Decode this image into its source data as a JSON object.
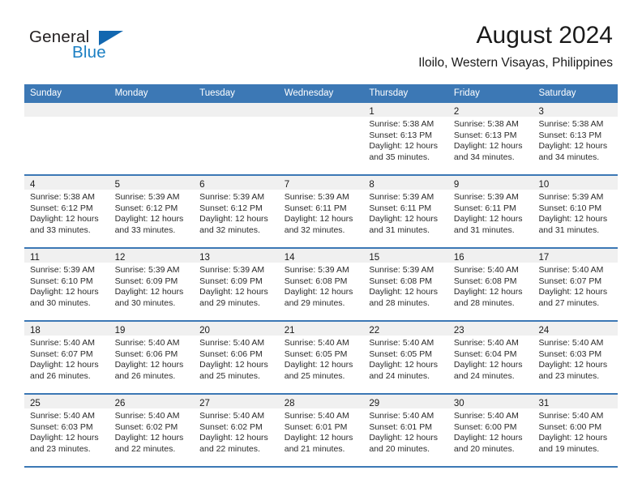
{
  "brand": {
    "name_part1": "General",
    "name_part2": "Blue"
  },
  "header": {
    "title": "August 2024",
    "location": "Iloilo, Western Visayas, Philippines"
  },
  "colors": {
    "header_blue": "#3c78b5",
    "brand_blue": "#1b7fc3",
    "day_band_gray": "#f0f0f0"
  },
  "weekdays": [
    "Sunday",
    "Monday",
    "Tuesday",
    "Wednesday",
    "Thursday",
    "Friday",
    "Saturday"
  ],
  "weeks": [
    [
      {
        "day": "",
        "sunrise": "",
        "sunset": "",
        "daylight1": "",
        "daylight2": ""
      },
      {
        "day": "",
        "sunrise": "",
        "sunset": "",
        "daylight1": "",
        "daylight2": ""
      },
      {
        "day": "",
        "sunrise": "",
        "sunset": "",
        "daylight1": "",
        "daylight2": ""
      },
      {
        "day": "",
        "sunrise": "",
        "sunset": "",
        "daylight1": "",
        "daylight2": ""
      },
      {
        "day": "1",
        "sunrise": "Sunrise: 5:38 AM",
        "sunset": "Sunset: 6:13 PM",
        "daylight1": "Daylight: 12 hours",
        "daylight2": "and 35 minutes."
      },
      {
        "day": "2",
        "sunrise": "Sunrise: 5:38 AM",
        "sunset": "Sunset: 6:13 PM",
        "daylight1": "Daylight: 12 hours",
        "daylight2": "and 34 minutes."
      },
      {
        "day": "3",
        "sunrise": "Sunrise: 5:38 AM",
        "sunset": "Sunset: 6:13 PM",
        "daylight1": "Daylight: 12 hours",
        "daylight2": "and 34 minutes."
      }
    ],
    [
      {
        "day": "4",
        "sunrise": "Sunrise: 5:38 AM",
        "sunset": "Sunset: 6:12 PM",
        "daylight1": "Daylight: 12 hours",
        "daylight2": "and 33 minutes."
      },
      {
        "day": "5",
        "sunrise": "Sunrise: 5:39 AM",
        "sunset": "Sunset: 6:12 PM",
        "daylight1": "Daylight: 12 hours",
        "daylight2": "and 33 minutes."
      },
      {
        "day": "6",
        "sunrise": "Sunrise: 5:39 AM",
        "sunset": "Sunset: 6:12 PM",
        "daylight1": "Daylight: 12 hours",
        "daylight2": "and 32 minutes."
      },
      {
        "day": "7",
        "sunrise": "Sunrise: 5:39 AM",
        "sunset": "Sunset: 6:11 PM",
        "daylight1": "Daylight: 12 hours",
        "daylight2": "and 32 minutes."
      },
      {
        "day": "8",
        "sunrise": "Sunrise: 5:39 AM",
        "sunset": "Sunset: 6:11 PM",
        "daylight1": "Daylight: 12 hours",
        "daylight2": "and 31 minutes."
      },
      {
        "day": "9",
        "sunrise": "Sunrise: 5:39 AM",
        "sunset": "Sunset: 6:11 PM",
        "daylight1": "Daylight: 12 hours",
        "daylight2": "and 31 minutes."
      },
      {
        "day": "10",
        "sunrise": "Sunrise: 5:39 AM",
        "sunset": "Sunset: 6:10 PM",
        "daylight1": "Daylight: 12 hours",
        "daylight2": "and 31 minutes."
      }
    ],
    [
      {
        "day": "11",
        "sunrise": "Sunrise: 5:39 AM",
        "sunset": "Sunset: 6:10 PM",
        "daylight1": "Daylight: 12 hours",
        "daylight2": "and 30 minutes."
      },
      {
        "day": "12",
        "sunrise": "Sunrise: 5:39 AM",
        "sunset": "Sunset: 6:09 PM",
        "daylight1": "Daylight: 12 hours",
        "daylight2": "and 30 minutes."
      },
      {
        "day": "13",
        "sunrise": "Sunrise: 5:39 AM",
        "sunset": "Sunset: 6:09 PM",
        "daylight1": "Daylight: 12 hours",
        "daylight2": "and 29 minutes."
      },
      {
        "day": "14",
        "sunrise": "Sunrise: 5:39 AM",
        "sunset": "Sunset: 6:08 PM",
        "daylight1": "Daylight: 12 hours",
        "daylight2": "and 29 minutes."
      },
      {
        "day": "15",
        "sunrise": "Sunrise: 5:39 AM",
        "sunset": "Sunset: 6:08 PM",
        "daylight1": "Daylight: 12 hours",
        "daylight2": "and 28 minutes."
      },
      {
        "day": "16",
        "sunrise": "Sunrise: 5:40 AM",
        "sunset": "Sunset: 6:08 PM",
        "daylight1": "Daylight: 12 hours",
        "daylight2": "and 28 minutes."
      },
      {
        "day": "17",
        "sunrise": "Sunrise: 5:40 AM",
        "sunset": "Sunset: 6:07 PM",
        "daylight1": "Daylight: 12 hours",
        "daylight2": "and 27 minutes."
      }
    ],
    [
      {
        "day": "18",
        "sunrise": "Sunrise: 5:40 AM",
        "sunset": "Sunset: 6:07 PM",
        "daylight1": "Daylight: 12 hours",
        "daylight2": "and 26 minutes."
      },
      {
        "day": "19",
        "sunrise": "Sunrise: 5:40 AM",
        "sunset": "Sunset: 6:06 PM",
        "daylight1": "Daylight: 12 hours",
        "daylight2": "and 26 minutes."
      },
      {
        "day": "20",
        "sunrise": "Sunrise: 5:40 AM",
        "sunset": "Sunset: 6:06 PM",
        "daylight1": "Daylight: 12 hours",
        "daylight2": "and 25 minutes."
      },
      {
        "day": "21",
        "sunrise": "Sunrise: 5:40 AM",
        "sunset": "Sunset: 6:05 PM",
        "daylight1": "Daylight: 12 hours",
        "daylight2": "and 25 minutes."
      },
      {
        "day": "22",
        "sunrise": "Sunrise: 5:40 AM",
        "sunset": "Sunset: 6:05 PM",
        "daylight1": "Daylight: 12 hours",
        "daylight2": "and 24 minutes."
      },
      {
        "day": "23",
        "sunrise": "Sunrise: 5:40 AM",
        "sunset": "Sunset: 6:04 PM",
        "daylight1": "Daylight: 12 hours",
        "daylight2": "and 24 minutes."
      },
      {
        "day": "24",
        "sunrise": "Sunrise: 5:40 AM",
        "sunset": "Sunset: 6:03 PM",
        "daylight1": "Daylight: 12 hours",
        "daylight2": "and 23 minutes."
      }
    ],
    [
      {
        "day": "25",
        "sunrise": "Sunrise: 5:40 AM",
        "sunset": "Sunset: 6:03 PM",
        "daylight1": "Daylight: 12 hours",
        "daylight2": "and 23 minutes."
      },
      {
        "day": "26",
        "sunrise": "Sunrise: 5:40 AM",
        "sunset": "Sunset: 6:02 PM",
        "daylight1": "Daylight: 12 hours",
        "daylight2": "and 22 minutes."
      },
      {
        "day": "27",
        "sunrise": "Sunrise: 5:40 AM",
        "sunset": "Sunset: 6:02 PM",
        "daylight1": "Daylight: 12 hours",
        "daylight2": "and 22 minutes."
      },
      {
        "day": "28",
        "sunrise": "Sunrise: 5:40 AM",
        "sunset": "Sunset: 6:01 PM",
        "daylight1": "Daylight: 12 hours",
        "daylight2": "and 21 minutes."
      },
      {
        "day": "29",
        "sunrise": "Sunrise: 5:40 AM",
        "sunset": "Sunset: 6:01 PM",
        "daylight1": "Daylight: 12 hours",
        "daylight2": "and 20 minutes."
      },
      {
        "day": "30",
        "sunrise": "Sunrise: 5:40 AM",
        "sunset": "Sunset: 6:00 PM",
        "daylight1": "Daylight: 12 hours",
        "daylight2": "and 20 minutes."
      },
      {
        "day": "31",
        "sunrise": "Sunrise: 5:40 AM",
        "sunset": "Sunset: 6:00 PM",
        "daylight1": "Daylight: 12 hours",
        "daylight2": "and 19 minutes."
      }
    ]
  ]
}
